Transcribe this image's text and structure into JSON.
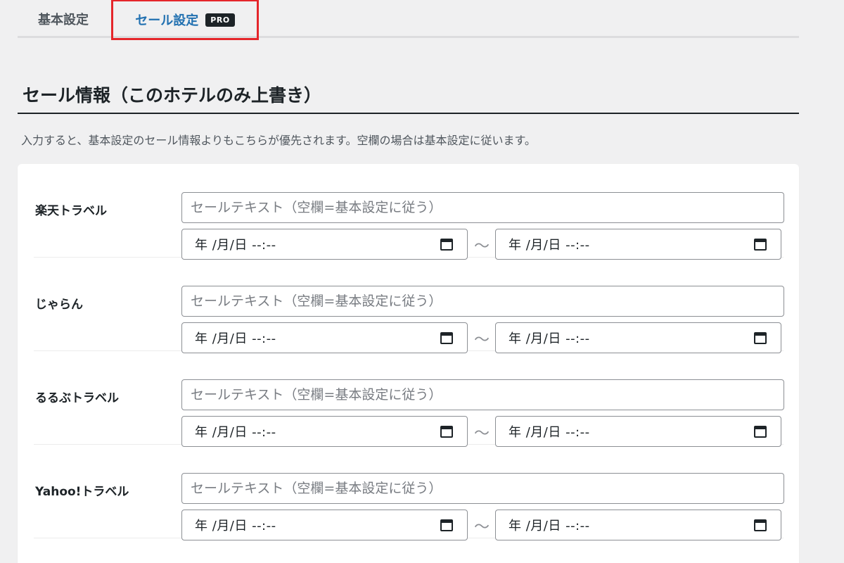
{
  "tabs": [
    {
      "label": "基本設定"
    },
    {
      "label": "セール設定",
      "badge": "PRO"
    }
  ],
  "section": {
    "title": "セール情報（このホテルのみ上書き）",
    "description": "入力すると、基本設定のセール情報よりもこちらが優先されます。空欄の場合は基本設定に従います。"
  },
  "rows": [
    {
      "label": "楽天トラベル",
      "placeholder": "セールテキスト（空欄=基本設定に従う）",
      "date_start": "年 /月/日 --:--",
      "separator": "〜",
      "date_end": "年 /月/日 --:--"
    },
    {
      "label": "じゃらん",
      "placeholder": "セールテキスト（空欄=基本設定に従う）",
      "date_start": "年 /月/日 --:--",
      "separator": "〜",
      "date_end": "年 /月/日 --:--"
    },
    {
      "label": "るるぶトラベル",
      "placeholder": "セールテキスト（空欄=基本設定に従う）",
      "date_start": "年 /月/日 --:--",
      "separator": "〜",
      "date_end": "年 /月/日 --:--"
    },
    {
      "label": "Yahoo!トラベル",
      "placeholder": "セールテキスト（空欄=基本設定に従う）",
      "date_start": "年 /月/日 --:--",
      "separator": "〜",
      "date_end": "年 /月/日 --:--"
    }
  ],
  "colors": {
    "active_tab": "#2271b1",
    "highlight_border": "#e5262b",
    "background": "#f0f0f1"
  }
}
